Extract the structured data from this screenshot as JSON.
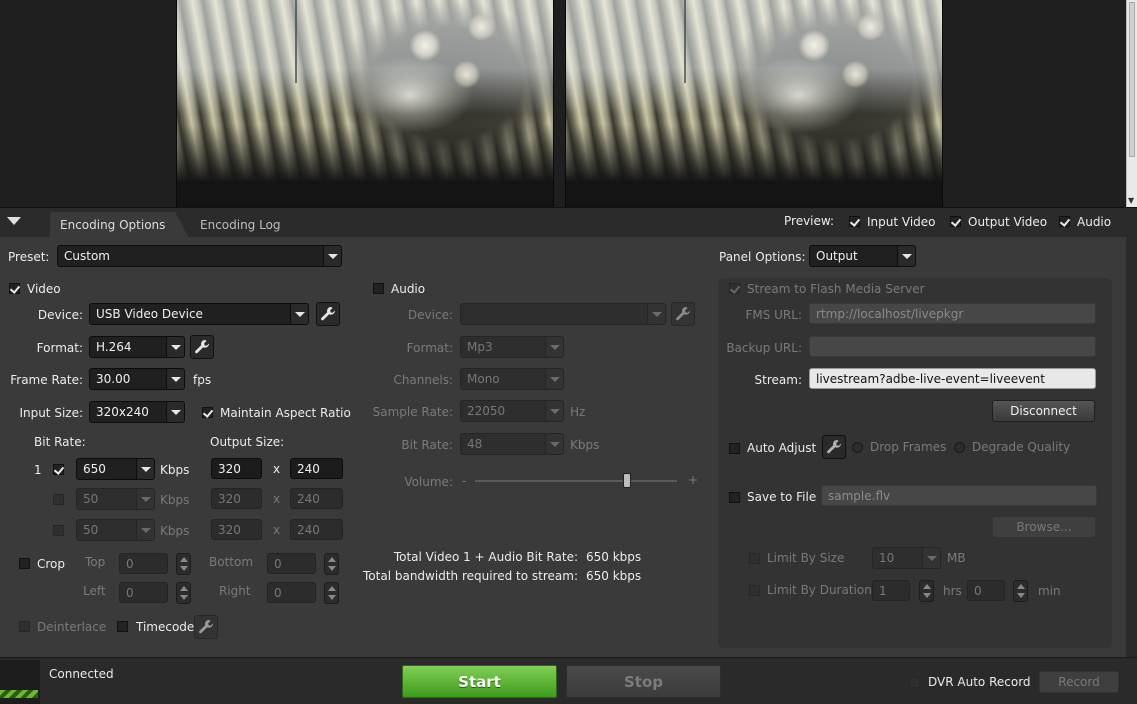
{
  "tabs": {
    "encoding_options": "Encoding Options",
    "encoding_log": "Encoding Log"
  },
  "preview": {
    "label": "Preview:",
    "input_video": "Input Video",
    "output_video": "Output Video",
    "audio": "Audio"
  },
  "preset": {
    "label": "Preset:",
    "value": "Custom"
  },
  "panel_options": {
    "label": "Panel Options:",
    "value": "Output"
  },
  "video": {
    "label": "Video",
    "device_label": "Device:",
    "device": "USB Video Device",
    "format_label": "Format:",
    "format": "H.264",
    "frame_rate_label": "Frame Rate:",
    "frame_rate": "30.00",
    "fps": "fps",
    "input_size_label": "Input Size:",
    "input_size": "320x240",
    "maintain_aspect": "Maintain Aspect Ratio",
    "bit_rate_label": "Bit Rate:",
    "output_size_label": "Output Size:",
    "kbps": "Kbps",
    "x": "x",
    "rows": [
      {
        "index": "1",
        "bitrate": "650",
        "width": "320",
        "height": "240"
      },
      {
        "index": "",
        "bitrate": "50",
        "width": "320",
        "height": "240"
      },
      {
        "index": "",
        "bitrate": "50",
        "width": "320",
        "height": "240"
      }
    ],
    "crop": "Crop",
    "top": "Top",
    "bottom": "Bottom",
    "left": "Left",
    "right": "Right",
    "crop_top": "0",
    "crop_bottom": "0",
    "crop_left": "0",
    "crop_right": "0",
    "deinterlace": "Deinterlace",
    "timecode": "Timecode"
  },
  "audio": {
    "label": "Audio",
    "device_label": "Device:",
    "device": "",
    "format_label": "Format:",
    "format": "Mp3",
    "channels_label": "Channels:",
    "channels": "Mono",
    "sample_rate_label": "Sample Rate:",
    "sample_rate": "22050",
    "hz": "Hz",
    "bit_rate_label": "Bit Rate:",
    "bit_rate": "48",
    "kbps": "Kbps",
    "volume_label": "Volume:",
    "minus": "-",
    "plus": "+",
    "volume_level": 0.75
  },
  "totals": {
    "total_label": "Total Video 1 + Audio Bit Rate:",
    "total_value": "650 kbps",
    "bandwidth_label": "Total bandwidth required to stream:",
    "bandwidth_value": "650 kbps"
  },
  "output": {
    "stream_to_fms": "Stream to Flash Media Server",
    "fms_url_label": "FMS URL:",
    "fms_url": "rtmp://localhost/livepkgr",
    "backup_url_label": "Backup URL:",
    "backup_url": "",
    "stream_label": "Stream:",
    "stream": "livestream?adbe-live-event=liveevent",
    "disconnect": "Disconnect",
    "auto_adjust": "Auto Adjust",
    "drop_frames": "Drop Frames",
    "degrade_quality": "Degrade Quality",
    "save_to_file": "Save to File",
    "file_name": "sample.flv",
    "browse": "Browse...",
    "limit_by_size": "Limit By Size",
    "size_value": "10",
    "mb": "MB",
    "limit_by_duration": "Limit By Duration",
    "hrs_value": "1",
    "hrs": "hrs",
    "min_value": "0",
    "min": "min"
  },
  "footer": {
    "status": "Connected",
    "start": "Start",
    "stop": "Stop",
    "dvr_auto_record": "DVR Auto Record",
    "record": "Record"
  },
  "colors": {
    "start_green": "#5cb533",
    "panel_bg": "#3a3a3a",
    "field_bg": "#1c1c1c"
  }
}
